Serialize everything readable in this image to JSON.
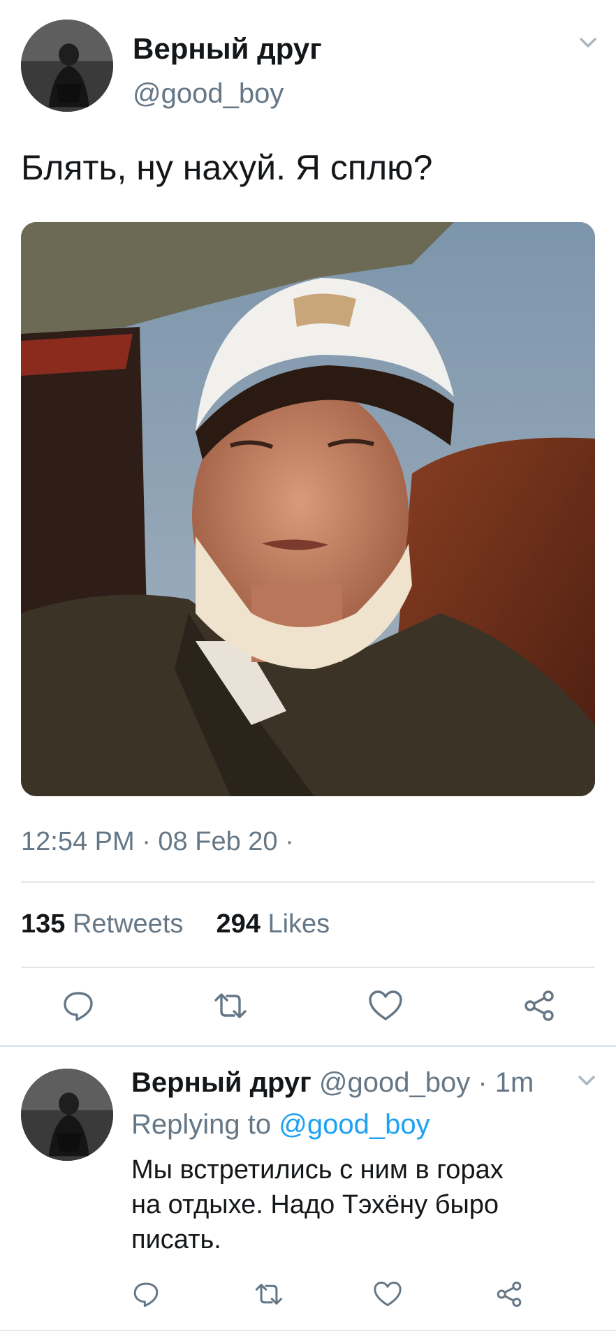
{
  "tweet": {
    "author_name": "Верный друг",
    "author_handle": "@good_boy",
    "text": "Блять, ну нахуй. Я сплю?",
    "timestamp": "12:54 PM · 08 Feb 20 ·",
    "retweets_count": "135",
    "retweets_label": "Retweets",
    "likes_count": "294",
    "likes_label": "Likes",
    "icons": [
      "reply-icon",
      "retweet-icon",
      "like-icon",
      "share-icon",
      "chevron-down-icon"
    ]
  },
  "reply": {
    "author_name": "Верный друг",
    "author_handle": "@good_boy",
    "time": "· 1m",
    "replying_label": "Replying to",
    "replying_handle": "@good_boy",
    "text_line1": "Мы встретились с ним в горах",
    "text_line2": "на отдыхе. Надо Тэхёну быро",
    "text_line3": "писать."
  },
  "colors": {
    "text": "#14171a",
    "secondary": "#657786",
    "link": "#1da1f2",
    "divider": "#e1e8ed",
    "icon": "#657786"
  }
}
